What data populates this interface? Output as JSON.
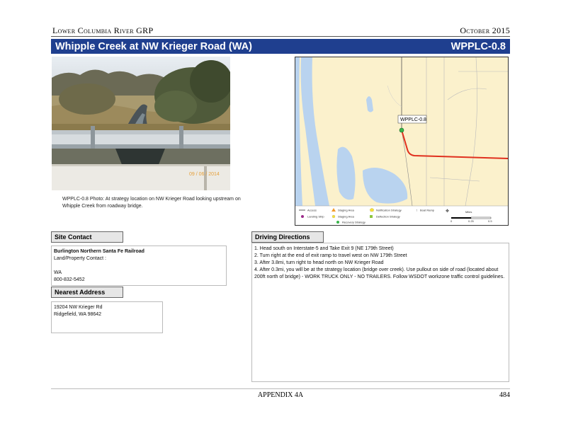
{
  "header": {
    "left": "Lower Columbia River GRP",
    "right": "October 2015"
  },
  "title_bar": {
    "title": "Whipple Creek at NW Krieger Road (WA)",
    "code": "WPPLC-0.8"
  },
  "photo": {
    "caption": "WPPLC-0.8 Photo: At strategy location on NW Krieger Road looking upstream on Whipple Creek from roadway bridge."
  },
  "map": {
    "site_label": "WPPLC-0.8",
    "legend": {
      "row1": [
        "Access",
        "Staging Area",
        "Notification Strategy",
        "Boat Ramp"
      ],
      "row2": [
        "Landing Strip",
        "Staging Area",
        "Deflection Strategy",
        "Recovery Strategy"
      ],
      "scale": [
        "0",
        "0.25",
        "0.5"
      ],
      "units": "Miles"
    },
    "colors": {
      "route": "#e0301e",
      "water": "#b9d3ef",
      "land": "#fbf1cc",
      "site_marker": "#39b54a"
    }
  },
  "site_contact": {
    "heading": "Site Contact",
    "organization": "Burlington Northern Santa Fe Railroad",
    "label": "Land/Property Contact :",
    "state": "WA",
    "phone": "800-832-5452"
  },
  "nearest_address": {
    "heading": "Nearest Address",
    "line1": "19204 NW Krieger Rd",
    "line2": "Ridgefield, WA 98642"
  },
  "driving_directions": {
    "heading": "Driving Directions",
    "steps": [
      "1. Head south on Interstate-5 and Take Exit 9 (NE 179th Street)",
      "2. Turn right at the end of exit ramp to travel west on NW 179th Street",
      "3. After 3.8mi, turn right to head north on NW Krieger Road",
      "4. After 0.3mi, you will be at the strategy location (bridge over creek). Use pullout on side of road (located about 200ft north of bridge) - WORK TRUCK ONLY - NO TRAILERS. Follow WSDOT workzone traffic control guidelines."
    ]
  },
  "footer": {
    "center": "APPENDIX 4A",
    "page": "484"
  }
}
